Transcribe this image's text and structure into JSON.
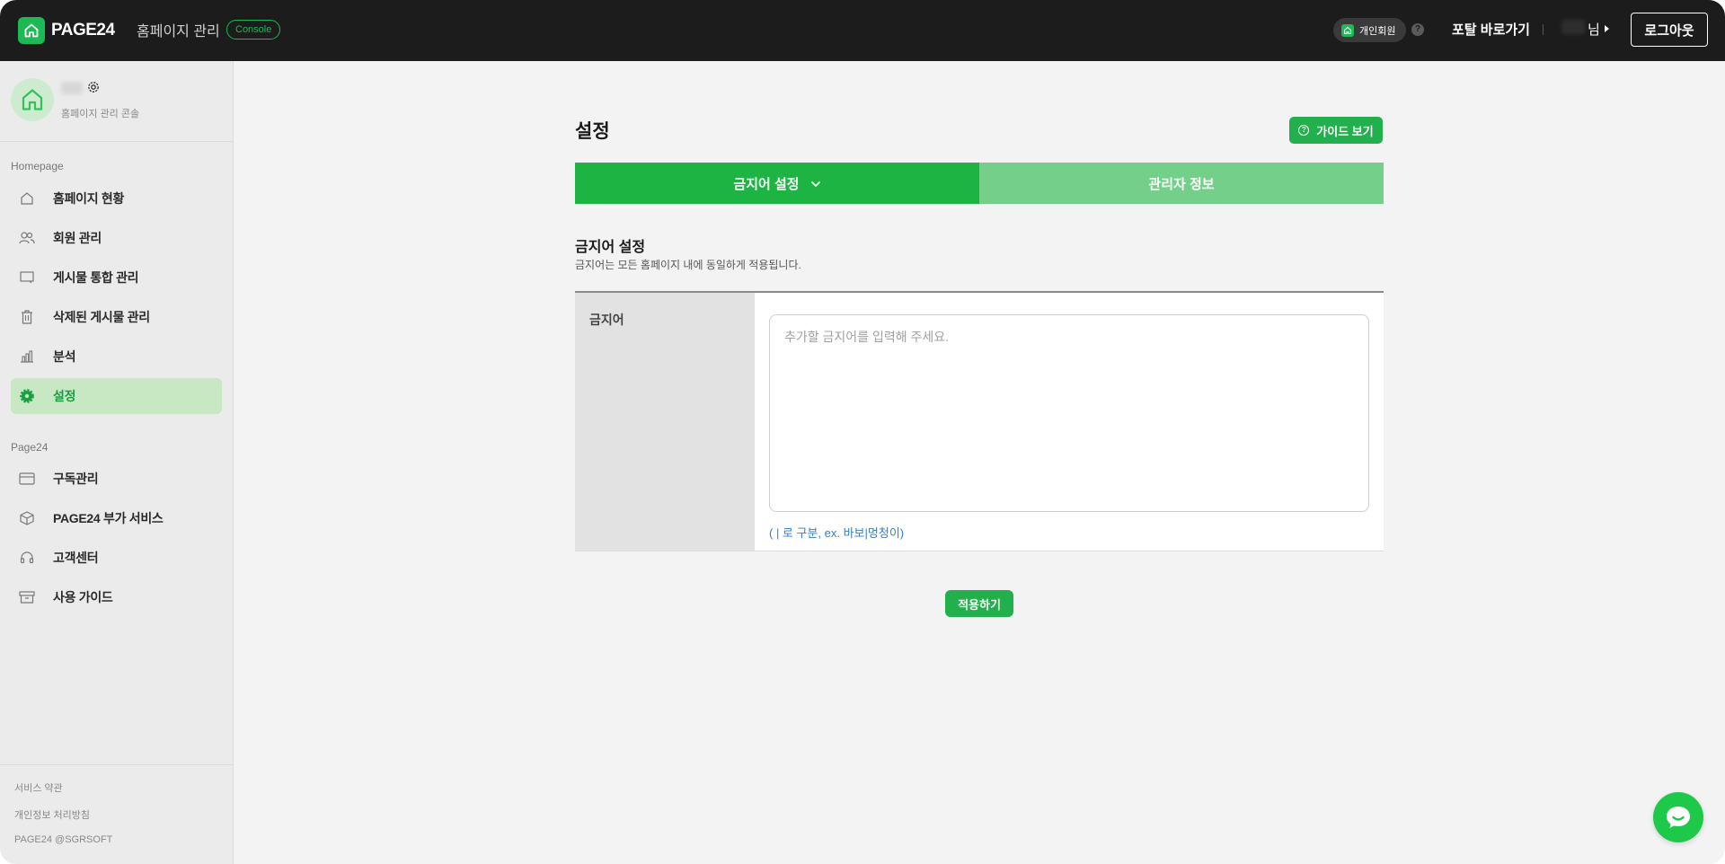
{
  "header": {
    "logo_text": "PAGE24",
    "app_name": "홈페이지 관리",
    "console_badge": "Console",
    "member_type": "개인회원",
    "help": "?",
    "portal_link": "포탈 바로가기",
    "user_suffix": "님",
    "logout_label": "로그아웃"
  },
  "sidebar": {
    "profile_subtitle": "홈페이지 관리 콘솔",
    "sections": [
      {
        "label": "Homepage"
      },
      {
        "label": "Page24"
      }
    ],
    "homepage_items": [
      {
        "label": "홈페이지 현황",
        "icon": "home-icon"
      },
      {
        "label": "회원 관리",
        "icon": "users-icon"
      },
      {
        "label": "게시물 통합 관리",
        "icon": "board-icon"
      },
      {
        "label": "삭제된 게시물 관리",
        "icon": "trash-icon"
      },
      {
        "label": "분석",
        "icon": "chart-icon"
      },
      {
        "label": "설정",
        "icon": "gear-icon",
        "active": true
      }
    ],
    "page24_items": [
      {
        "label": "구독관리",
        "icon": "card-icon"
      },
      {
        "label": "PAGE24 부가 서비스",
        "icon": "box-icon"
      },
      {
        "label": "고객센터",
        "icon": "headset-icon"
      },
      {
        "label": "사용 가이드",
        "icon": "archive-icon"
      }
    ],
    "footer": {
      "terms": "서비스 약관",
      "privacy": "개인정보 처리방침",
      "copyright": "PAGE24 @SGRSOFT"
    }
  },
  "main": {
    "page_title": "설정",
    "guide_button": "가이드 보기",
    "tabs": [
      {
        "label": "금지어 설정",
        "active": true
      },
      {
        "label": "관리자 정보",
        "active": false
      }
    ],
    "section_title": "금지어 설정",
    "section_desc": "금지어는 모든 홈페이지 내에 동일하게 적용됩니다.",
    "form": {
      "label": "금지어",
      "placeholder": "추가할 금지어를 입력해 주세요.",
      "value": "",
      "hint": "( | 로 구분, ex. 바보|멍청이)"
    },
    "apply_button": "적용하기"
  },
  "colors": {
    "brand_green": "#1db954",
    "tab_active": "#1db443",
    "tab_inactive": "#74cf8a",
    "header_bg": "#1c1c1c",
    "hint_blue": "#2f7ecf"
  }
}
